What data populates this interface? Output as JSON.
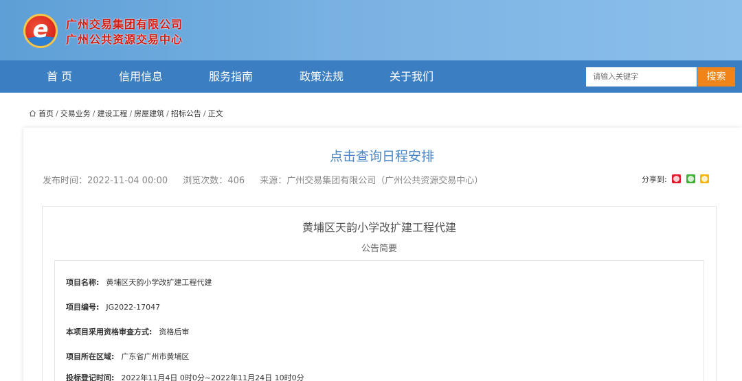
{
  "header": {
    "org_line1": "广州交易集团有限公司",
    "org_line2": "广州公共资源交易中心",
    "logo_icon": "e-logo-icon"
  },
  "nav": {
    "items": [
      "首 页",
      "信用信息",
      "服务指南",
      "政策法规",
      "关于我们"
    ],
    "search_placeholder": "请输入关键字",
    "search_label": "搜索"
  },
  "breadcrumb": [
    "首页",
    "交易业务",
    "建设工程",
    "房屋建筑",
    "招标公告",
    "正文"
  ],
  "article": {
    "title": "点击查询日程安排",
    "publish_time": "发布时间：2022-11-04 00:00",
    "views": "浏览次数：406",
    "source": "来源：广州交易集团有限公司（广州公共资源交易中心）",
    "share_label": "分享到:",
    "share_icons": [
      "weibo-icon",
      "wechat-icon",
      "qq-icon"
    ]
  },
  "panel": {
    "project_title": "黄埔区天韵小学改扩建工程代建",
    "subtitle": "公告简要",
    "fields": [
      {
        "key": "项目名称:",
        "value": "黄埔区天韵小学改扩建工程代建"
      },
      {
        "key": "项目编号:",
        "value": "JG2022-17047"
      },
      {
        "key": "本项目采用资格审查方式:",
        "value": "资格后审"
      },
      {
        "key": "项目所在区域:",
        "value": "广东省广州市黄埔区"
      },
      {
        "key": "投标登记时间:",
        "value": "2022年11月4日 0时0分~2022年11月24日 10时0分"
      }
    ]
  },
  "colors": {
    "nav_bg": "#3b7fc2",
    "search_btn": "#f08419",
    "title_blue": "#4a86c5",
    "org_red": "#d21a10"
  }
}
